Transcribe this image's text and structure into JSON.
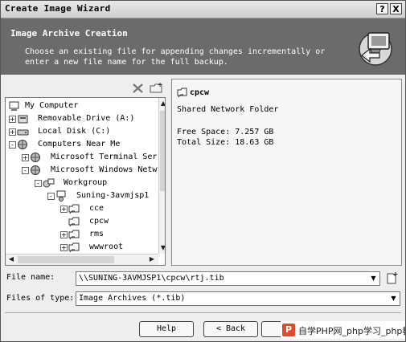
{
  "window": {
    "title": "Create Image Wizard",
    "help_button": "?",
    "close_button": "X"
  },
  "banner": {
    "heading": "Image Archive Creation",
    "description_line1": "Choose an existing file for appending changes incrementally or",
    "description_line2": "enter a new file name for the full backup."
  },
  "tree": {
    "nodes": [
      {
        "label": "My Computer",
        "icon": "computer-icon",
        "expander": ""
      },
      {
        "label": "Removable Drive (A:)",
        "icon": "floppy-drive-icon",
        "expander": "+"
      },
      {
        "label": "Local Disk (C:)",
        "icon": "hard-disk-icon",
        "expander": "+"
      },
      {
        "label": "Computers Near Me",
        "icon": "network-globe-icon",
        "expander": "-"
      },
      {
        "label": "Microsoft Terminal Ser",
        "icon": "network-globe-icon",
        "expander": "+"
      },
      {
        "label": "Microsoft Windows Netw",
        "icon": "network-globe-icon",
        "expander": "-"
      },
      {
        "label": "Workgroup",
        "icon": "workgroup-icon",
        "expander": "-"
      },
      {
        "label": "Suning-3avmjsp1",
        "icon": "network-computer-icon",
        "expander": "-"
      },
      {
        "label": "cce",
        "icon": "shared-folder-icon",
        "expander": "+"
      },
      {
        "label": "cpcw",
        "icon": "shared-folder-icon",
        "expander": ""
      },
      {
        "label": "rms",
        "icon": "shared-folder-icon",
        "expander": "+"
      },
      {
        "label": "wwwroot",
        "icon": "shared-folder-icon",
        "expander": "+"
      }
    ]
  },
  "info": {
    "name": "cpcw",
    "type": "Shared Network Folder",
    "free_space": "Free Space: 7.257 GB",
    "total_size": "Total Size: 18.63 GB"
  },
  "file_name": {
    "label": "File name:",
    "value": "\\\\SUNING-3AVMJSP1\\cpcw\\rtj.tib"
  },
  "files_of_type": {
    "label": "Files of type:",
    "value": "Image Archives (*.tib)"
  },
  "buttons": {
    "help": "Help",
    "back": "< Back"
  },
  "watermark": {
    "logo": "P",
    "text": "自学PHP网_php学习_php教"
  }
}
